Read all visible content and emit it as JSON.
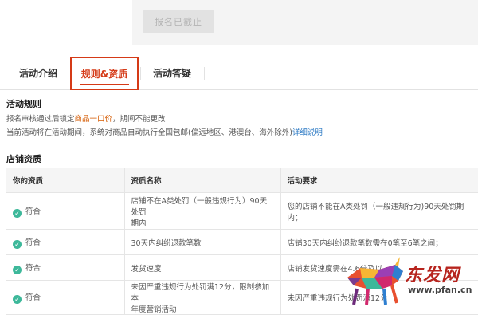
{
  "top": {
    "closed_button": "报名已截止"
  },
  "tabs": [
    {
      "label": "活动介绍",
      "active": false
    },
    {
      "label": "规则&资质",
      "active": true
    },
    {
      "label": "活动答疑",
      "active": false
    }
  ],
  "rules": {
    "title": "活动规则",
    "line1_pre": "报名审核通过后锁定",
    "line1_hl": "商品一口价",
    "line1_post": "，期间不能更改",
    "line2_pre": "当前活动将在活动期间，系统对商品自动执行全国包邮(偏远地区、港澳台、海外除外)",
    "line2_link": "详细说明"
  },
  "qualification": {
    "title": "店铺资质",
    "columns": [
      "你的资质",
      "资质名称",
      "活动要求"
    ],
    "rows": [
      {
        "status": "符合",
        "name": [
          "店铺不在A类处罚（一般违规行为）90天处罚",
          "期内"
        ],
        "requirement": "您的店铺不能在A类处罚（一般违规行为)90天处罚期内；"
      },
      {
        "status": "符合",
        "name": [
          "30天内纠纷退款笔数"
        ],
        "requirement": "店铺30天内纠纷退款笔数需在0笔至6笔之间；"
      },
      {
        "status": "符合",
        "name": [
          "发货速度"
        ],
        "requirement": "店铺发货速度需在4.6分及以上；"
      },
      {
        "status": "符合",
        "name": [
          "未因严重违规行为处罚满12分，限制参加本",
          "年度营销活动"
        ],
        "requirement": "未因严重违规行为处罚满12分"
      }
    ]
  },
  "watermark": {
    "text": "东发网",
    "url": "www.pfan.cn"
  }
}
